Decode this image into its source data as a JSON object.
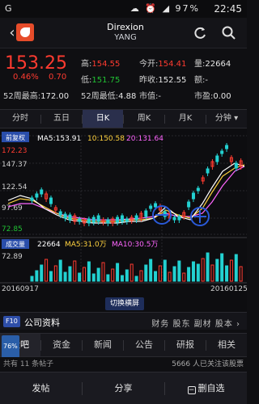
{
  "status": {
    "left": "G",
    "battery": "97%",
    "time": "22:45"
  },
  "header": {
    "title": "Direxion",
    "subtitle": "YANG",
    "back_icon": "back-arrow-icon",
    "refresh_icon": "refresh-icon",
    "search_icon": "search-icon"
  },
  "quote": {
    "price": "153.25",
    "change_pct": "0.46%",
    "change": "0.70",
    "high_label": "高:",
    "high": "154.55",
    "low_label": "低:",
    "low": "151.75",
    "open_label": "今开:",
    "open": "154.41",
    "prev_label": "昨收:",
    "prev": "152.55",
    "vol_label": "量:",
    "vol": "22664",
    "amt_label": "额:",
    "amt": "-",
    "w52h_label": "52周最高:",
    "w52h": "172.00",
    "w52l_label": "52周最低:",
    "w52l": "4.88",
    "mcap_label": "市值:",
    "mcap": "-",
    "pe_label": "市盈:",
    "pe": "0.00"
  },
  "tabs": [
    "分时",
    "五日",
    "日K",
    "周K",
    "月K",
    "分钟"
  ],
  "chart": {
    "main_label": "前复权",
    "ma5": "MA5:153.91",
    "ma10": "10:150.58",
    "ma20": "20:131.64",
    "y_ticks": [
      "172.23",
      "147.37",
      "122.54",
      "97.69",
      "72.85"
    ],
    "vol_label": "成交量",
    "vol_value": "22664",
    "vma5": "MA5:31.0万",
    "vma10": "MA10:30.5万",
    "vol_tick": "72.89",
    "date_start": "20160917",
    "date_end": "20160125",
    "colors": {
      "up": "#ff3b30",
      "down": "#23d1d1",
      "ma5": "#ffffff",
      "ma10": "#ffd23f",
      "ma20": "#ff66ff",
      "highlight": "#2a5ad8"
    }
  },
  "switch_label": "切换横屏",
  "company": {
    "badge": "F10",
    "title": "公司资料",
    "links": "财务 股东 副材 股本 ›"
  },
  "subtabs": {
    "pct": "76%",
    "items": [
      "股吧",
      "资金",
      "新闻",
      "公告",
      "研报",
      "相关"
    ]
  },
  "news": {
    "left": "共有 11 条帖子",
    "right": "5666 人已关注该股票"
  },
  "bottom": {
    "post": "发帖",
    "share": "分享",
    "watch": "删自选"
  }
}
